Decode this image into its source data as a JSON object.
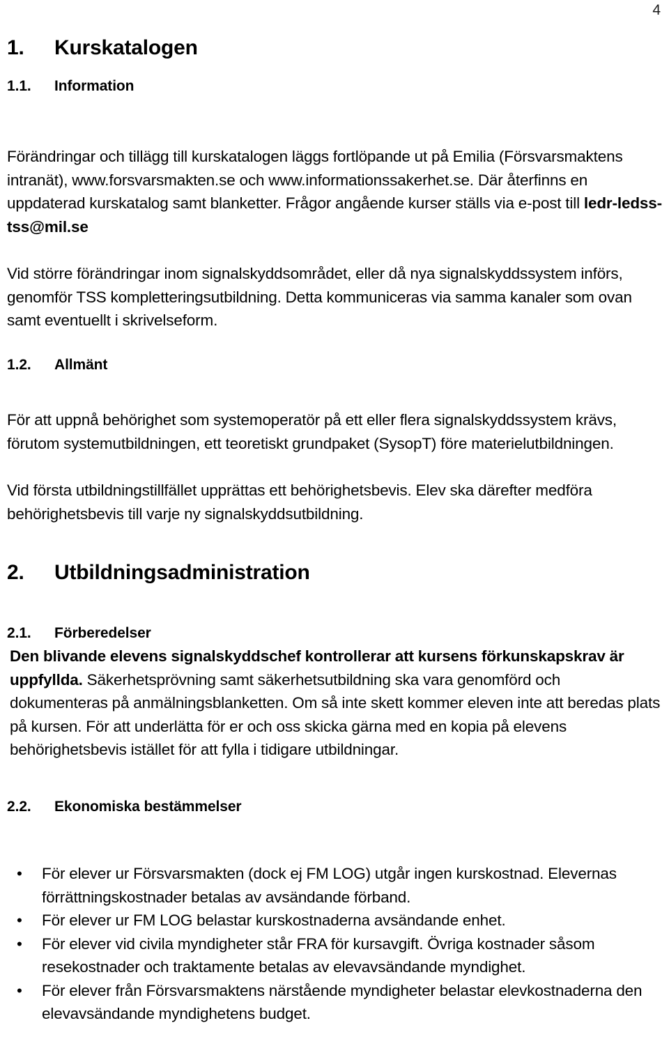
{
  "page": {
    "number": "4",
    "language": "sv"
  },
  "sections": {
    "h1_kurskatalogen": {
      "number": "1.",
      "title": "Kurskatalogen"
    },
    "h2_information": {
      "number": "1.1.",
      "title": "Information"
    },
    "h2_allmant": {
      "number": "1.2.",
      "title": "Allmänt"
    },
    "h1_utbildningsadministration": {
      "number": "2.",
      "title": "Utbildningsadministration"
    },
    "h2_forberedelser": {
      "number": "2.1.",
      "title": "Förberedelser"
    },
    "h2_ekonomiska": {
      "number": "2.2.",
      "title": "Ekonomiska bestämmelser"
    }
  },
  "paragraphs": {
    "information_p1_plain": "Förändringar och tillägg till kurskatalogen läggs fortlöpande ut på Emilia (Försvarsmaktens intranät), www.forsvarsmakten.se och www.informationssakerhet.se. Där återfinns en uppdaterad kurskatalog samt blanketter. Frågor angående kurser ställs via e-post till ",
    "information_p1_bold_email": "ledr-ledss-tss@mil.se",
    "information_p2": "Vid större förändringar inom signalskyddsområdet, eller då nya signalskyddssystem införs, genomför TSS kompletteringsutbildning. Detta kommuniceras via samma kanaler som ovan samt eventuellt i skrivelseform.",
    "allmant_p1": "För att uppnå behörighet som systemoperatör på ett eller flera signalskyddssystem krävs, förutom systemutbildningen, ett teoretiskt grundpaket (SysopT) före materielutbildningen.",
    "allmant_p2": "Vid första utbildningstillfället upprättas ett behörighetsbevis.  Elev ska därefter medföra behörighetsbevis till varje ny signalskyddsutbildning.",
    "forberedelser_p1_bold": "Den blivande elevens signalskyddschef kontrollerar att kursens förkunskapskrav är uppfyllda.",
    "forberedelser_p1_plain": " Säkerhetsprövning samt säkerhetsutbildning ska vara genomförd och dokumenteras på anmälningsblanketten. Om så inte skett kommer eleven inte att beredas plats på kursen. För att underlätta för er och oss skicka gärna med en kopia på elevens behörighetsbevis istället för att fylla i tidigare utbildningar."
  },
  "ekonomiska_bullets": [
    {
      "marker": "•",
      "text": "För elever ur Försvarsmakten (dock ej FM LOG) utgår ingen kurskostnad. Elevernas förrättningskostnader betalas av avsändande förband."
    },
    {
      "marker": "•",
      "text": "För elever ur FM LOG belastar kurskostnaderna avsändande enhet."
    },
    {
      "marker": "•",
      "text": "För elever vid civila myndigheter står FRA för kursavgift. Övriga kostnader såsom resekostnader och traktamente betalas av elevavsändande myndighet."
    },
    {
      "marker": "•",
      "text": "För elever från Försvarsmaktens närstående myndigheter belastar elevkostnaderna den elevavsändande myndighetens budget."
    }
  ]
}
